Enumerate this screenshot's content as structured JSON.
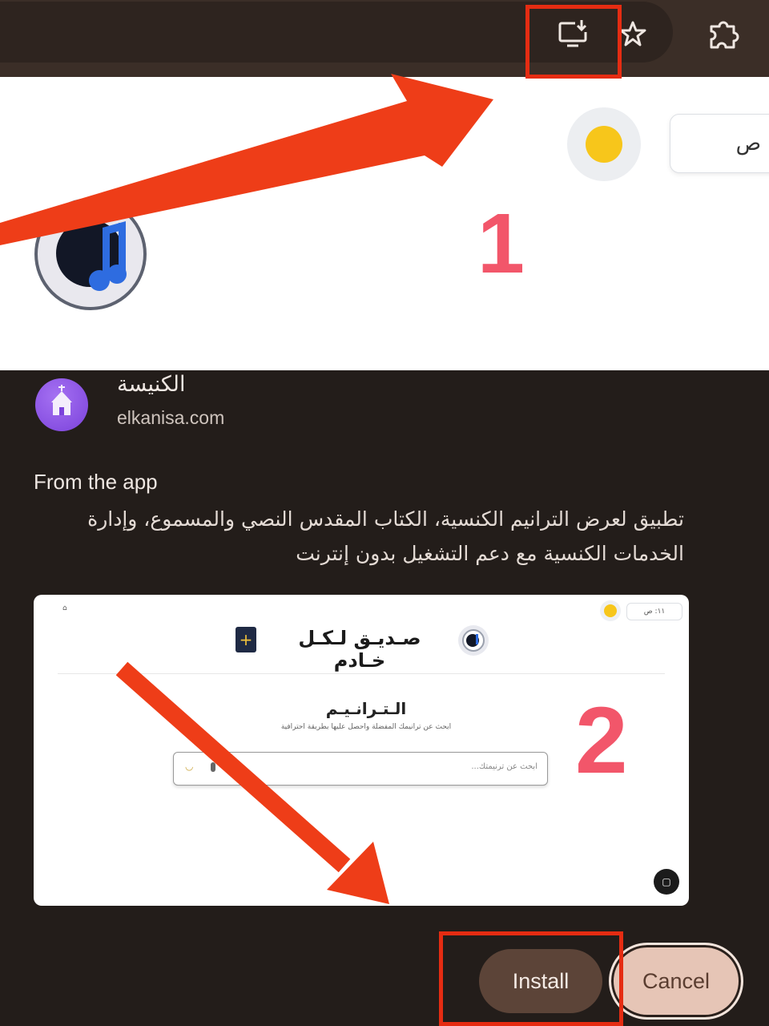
{
  "toolbar": {
    "install_icon": "install-app-icon",
    "star_icon": "bookmark-star-icon",
    "extensions_icon": "puzzle-extensions-icon"
  },
  "page": {
    "time_text": "١١: ص",
    "theme_icon": "sun-theme-icon",
    "logo": "music-note-logo"
  },
  "dialog": {
    "app_name": "الكنيسة",
    "app_domain": "elkanisa.com",
    "from_heading": "From the app",
    "description": "تطبيق لعرض الترانيم الكنسية، الكتاب المقدس النصي والمسموع، وإدارة الخدمات الكنسية مع دعم التشغيل بدون إنترنت",
    "install_label": "Install",
    "cancel_label": "Cancel"
  },
  "preview": {
    "title": "صـديـق لـكـل خـادم",
    "section_title": "الـتـرانـيـم",
    "subtitle": "ابحث عن ترانيمك المفضلة واحصل عليها بطريقة احترافية",
    "search_placeholder": "ابحث عن ترنيمتك..."
  },
  "annotations": {
    "step_1": "1",
    "step_2": "2",
    "highlight_color": "#e52c12",
    "step_color": "#f2566a"
  }
}
